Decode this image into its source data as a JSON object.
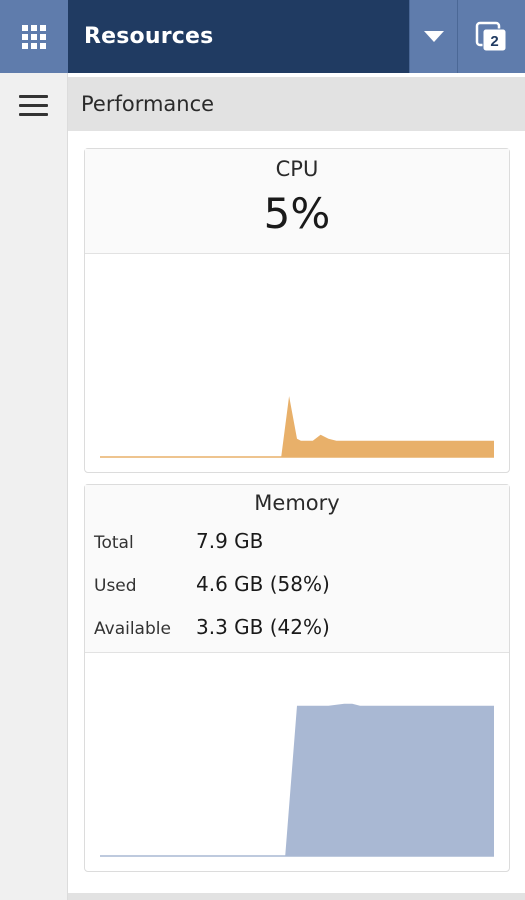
{
  "header": {
    "title": "Resources",
    "badge_count": "2",
    "apps_icon": "grid-icon",
    "dropdown_icon": "triangle-down-icon",
    "windows_icon": "windows-stack-icon",
    "bar_color": "#203b62",
    "button_color": "#5f7cac"
  },
  "section": {
    "title": "Performance",
    "menu_icon": "hamburger-menu-icon"
  },
  "cpu": {
    "title": "CPU",
    "value": "5%",
    "color": "#e8b06a"
  },
  "memory": {
    "title": "Memory",
    "rows": [
      {
        "label": "Total",
        "value": "7.9 GB"
      },
      {
        "label": "Used",
        "value": "4.6 GB (58%)"
      },
      {
        "label": "Available",
        "value": "3.3 GB (42%)"
      }
    ],
    "color": "#a9b8d3"
  },
  "chart_data": [
    {
      "type": "area",
      "ylim": [
        0,
        100
      ],
      "x": [
        0,
        46,
        48,
        50,
        51,
        52,
        54,
        56,
        58,
        60,
        62,
        64,
        66,
        68,
        70,
        80,
        90,
        100
      ],
      "series": [
        {
          "values": [
            0,
            0,
            30,
            9,
            8,
            8,
            8,
            11,
            9,
            8,
            8,
            8,
            8,
            8,
            8,
            8,
            8,
            8
          ]
        }
      ]
    },
    {
      "type": "area",
      "ylim": [
        0,
        100
      ],
      "x": [
        0,
        47,
        50,
        58,
        62,
        64,
        66,
        70,
        80,
        100
      ],
      "series": [
        {
          "values": [
            0,
            0,
            74,
            74,
            75,
            75,
            74,
            74,
            74,
            74
          ]
        }
      ]
    }
  ]
}
